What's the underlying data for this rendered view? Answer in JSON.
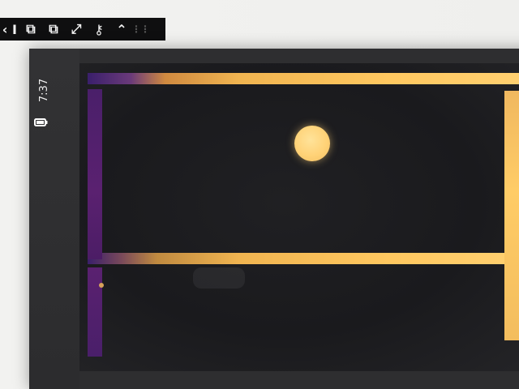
{
  "toolbar": {
    "items": [
      {
        "name": "pin-icon",
        "label": "‹"
      },
      {
        "name": "separator-icon",
        "label": "I"
      },
      {
        "name": "window-mode-icon",
        "label": "⧉"
      },
      {
        "name": "window-mode-2-icon",
        "label": "⧉"
      },
      {
        "name": "fullscreen-icon",
        "label": "⤢"
      },
      {
        "name": "key-icon",
        "label": "⚷"
      },
      {
        "name": "collapse-up-icon",
        "label": "⌃"
      },
      {
        "name": "drag-grip-icon",
        "label": "⋮⋮"
      }
    ]
  },
  "status": {
    "time": "7:37",
    "battery_icon": "battery-icon"
  },
  "colors": {
    "ball": "#ffd277",
    "wall_orange": "#ffc860",
    "wall_purple": "#4a1f6a",
    "background": "#1f1f22"
  }
}
